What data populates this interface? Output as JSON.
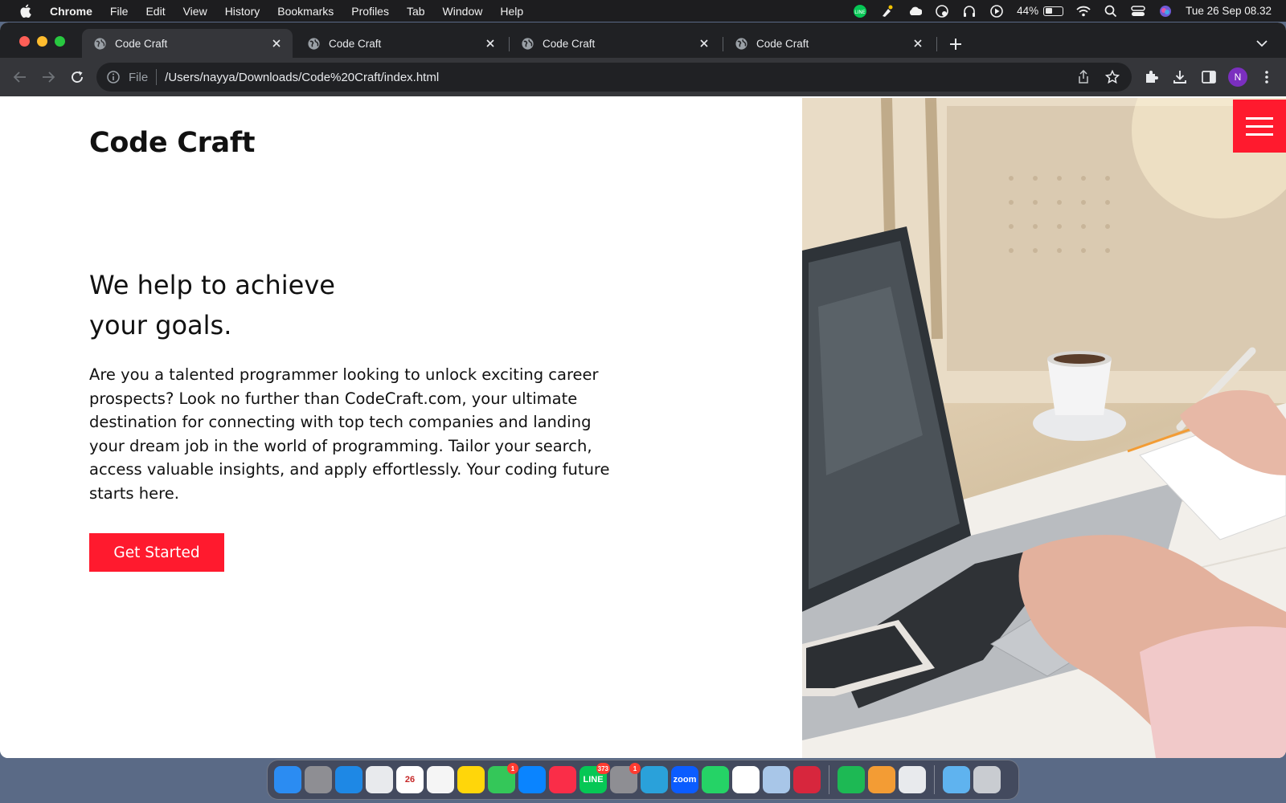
{
  "menubar": {
    "app_name": "Chrome",
    "items": [
      "File",
      "Edit",
      "View",
      "History",
      "Bookmarks",
      "Profiles",
      "Tab",
      "Window",
      "Help"
    ],
    "battery_percent": "44%",
    "battery_level": 0.44,
    "datetime": "Tue 26 Sep  08.32"
  },
  "browser": {
    "tabs": [
      {
        "title": "Code Craft",
        "active": true
      },
      {
        "title": "Code Craft",
        "active": false
      },
      {
        "title": "Code Craft",
        "active": false
      },
      {
        "title": "Code Craft",
        "active": false
      }
    ],
    "omnibox": {
      "scheme_label": "File",
      "url": "/Users/nayya/Downloads/Code%20Craft/index.html"
    },
    "profile_initial": "N"
  },
  "page": {
    "brand": "Code Craft",
    "hero_title_line1": "We help to achieve",
    "hero_title_line2": "your goals.",
    "hero_text": "Are you a talented programmer looking to unlock exciting career prospects? Look no further than CodeCraft.com, your ultimate destination for connecting with top tech companies and landing your dream job in the world of programming. Tailor your search, access valuable insights, and apply effortlessly. Your coding future starts here.",
    "cta_label": "Get Started",
    "accent_color": "#ff1a2e"
  },
  "dock": {
    "apps": [
      {
        "name": "finder-app-icon",
        "color": "#2b8cf2",
        "label": "",
        "badge": ""
      },
      {
        "name": "launchpad-app-icon",
        "color": "#8e8e93",
        "label": "",
        "badge": ""
      },
      {
        "name": "safari-app-icon",
        "color": "#1e88e5",
        "label": "",
        "badge": ""
      },
      {
        "name": "chrome-app-icon",
        "color": "#e8eaed",
        "label": "",
        "badge": ""
      },
      {
        "name": "calendar-app-icon",
        "color": "#ffffff",
        "label": "26",
        "badge": ""
      },
      {
        "name": "reminders-app-icon",
        "color": "#f5f5f5",
        "label": "",
        "badge": ""
      },
      {
        "name": "notes-app-icon",
        "color": "#ffd60a",
        "label": "",
        "badge": ""
      },
      {
        "name": "messages-app-icon",
        "color": "#34c759",
        "label": "",
        "badge": "1"
      },
      {
        "name": "app-store-app-icon",
        "color": "#0a84ff",
        "label": "",
        "badge": ""
      },
      {
        "name": "music-app-icon",
        "color": "#fa2d48",
        "label": "",
        "badge": ""
      },
      {
        "name": "line-app-icon",
        "color": "#06c755",
        "label": "LINE",
        "badge": "373"
      },
      {
        "name": "system-settings-app-icon",
        "color": "#8e8e93",
        "label": "",
        "badge": "1"
      },
      {
        "name": "telegram-app-icon",
        "color": "#2aa1da",
        "label": "",
        "badge": ""
      },
      {
        "name": "zoom-app-icon",
        "color": "#0b5cff",
        "label": "zoom",
        "badge": ""
      },
      {
        "name": "whatsapp-app-icon",
        "color": "#25d366",
        "label": "",
        "badge": ""
      },
      {
        "name": "vscode-app-icon",
        "color": "#ffffff",
        "label": "",
        "badge": ""
      },
      {
        "name": "cube-app-icon",
        "color": "#a8c6e8",
        "label": "",
        "badge": ""
      },
      {
        "name": "photo-booth-app-icon",
        "color": "#d7263d",
        "label": "",
        "badge": ""
      },
      {
        "name": "spotify-app-icon",
        "color": "#1db954",
        "label": "",
        "badge": ""
      },
      {
        "name": "fruit-app-icon",
        "color": "#f39c34",
        "label": "",
        "badge": ""
      },
      {
        "name": "chrome-alt-app-icon",
        "color": "#e8eaed",
        "label": "",
        "badge": ""
      },
      {
        "name": "downloads-folder-icon",
        "color": "#5fb3ef",
        "label": "",
        "badge": ""
      },
      {
        "name": "trash-icon",
        "color": "#c9ccd1",
        "label": "",
        "badge": ""
      }
    ]
  }
}
